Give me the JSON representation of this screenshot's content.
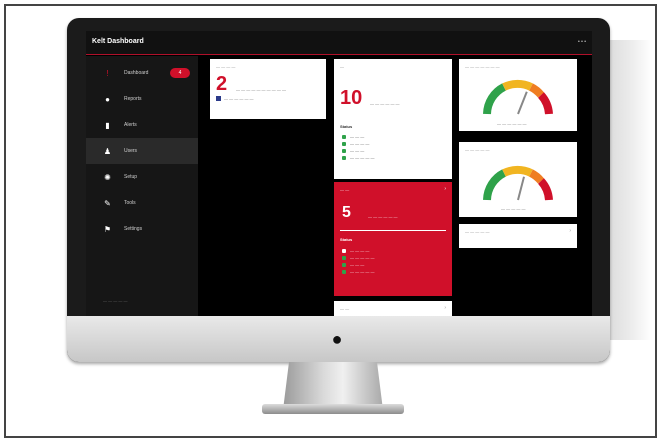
{
  "app": {
    "title": "Kelt Dashboard",
    "topbar_right": "• •  •"
  },
  "sidebar": {
    "items": [
      {
        "label": "Dashboard",
        "icon": "alert-icon",
        "badge": "4"
      },
      {
        "label": "Reports",
        "icon": "info-icon"
      },
      {
        "label": "Alerts",
        "icon": "chart-icon"
      },
      {
        "label": "Users",
        "icon": "user-icon"
      },
      {
        "label": "Setup",
        "icon": "settings-icon"
      },
      {
        "label": "Tools",
        "icon": "wrench-icon"
      },
      {
        "label": "Settings",
        "icon": "tag-icon"
      }
    ],
    "footer": "— — — — —"
  },
  "cards": {
    "summary": {
      "title": "— — — —",
      "number": "2",
      "line1": "— — — — — — — — — —",
      "line2": "— — — — — —"
    },
    "status_ok": {
      "title": "—",
      "number": "10",
      "subtitle": "— — — — — —",
      "section": "Status",
      "items": [
        "— — —",
        "— — — —",
        "— — —",
        "— — — — —"
      ]
    },
    "status_alert": {
      "title": "— —",
      "number": "5",
      "subtitle": "— — — — — —",
      "section": "Status",
      "items": [
        "— — — —",
        "— — — — —",
        "— — —",
        "— — — — —"
      ],
      "accent": "#d0102a"
    },
    "gauge1": {
      "title": "— — — — — — —",
      "caption": "— — — — — —",
      "value_fraction": 0.62
    },
    "gauge2": {
      "title": "— — — — —",
      "caption": "— — — — —",
      "value_fraction": 0.58
    },
    "small": {
      "title": "— — — — —"
    },
    "bottom": {
      "title": "— —"
    }
  },
  "colors": {
    "accent": "#d0102a",
    "ok": "#2fa24a",
    "gauge_green": "#2fa24a",
    "gauge_yellow": "#f1b521",
    "gauge_orange": "#ef7d22",
    "gauge_red": "#d0102a"
  }
}
